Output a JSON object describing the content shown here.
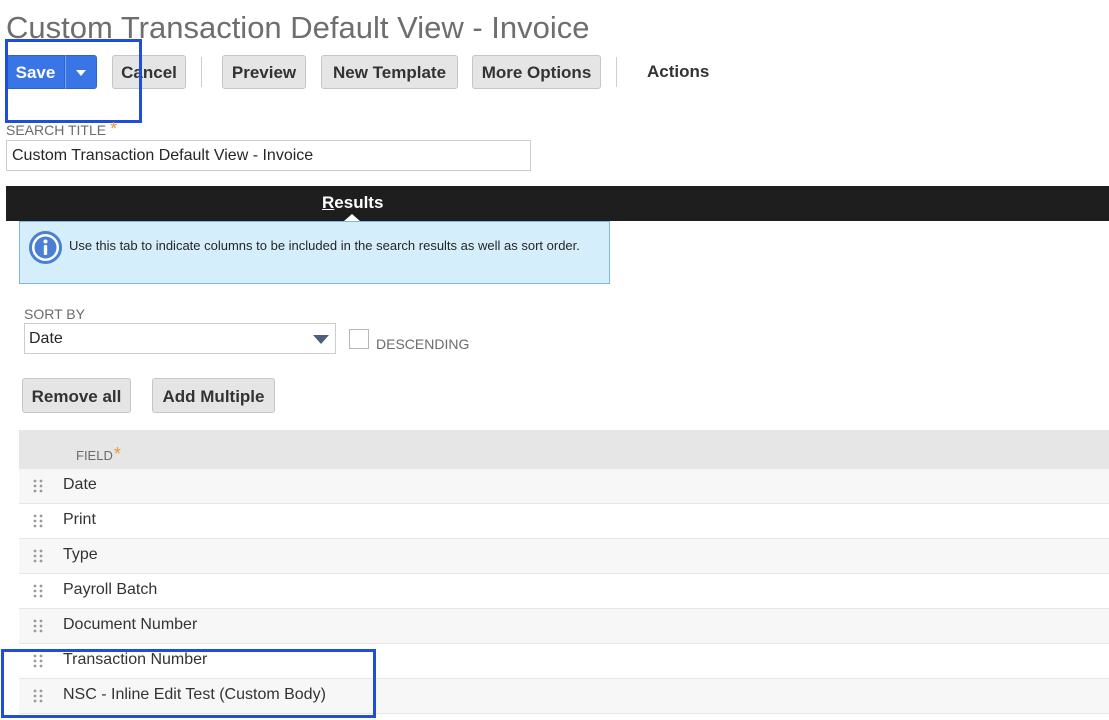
{
  "page": {
    "title": "Custom Transaction Default View - Invoice"
  },
  "toolbar": {
    "save_label": "Save",
    "cancel_label": "Cancel",
    "preview_label": "Preview",
    "new_template_label": "New Template",
    "more_options_label": "More Options",
    "actions_label": "Actions"
  },
  "search_title": {
    "label": "SEARCH TITLE",
    "required_mark": "*",
    "value": "Custom Transaction Default View - Invoice"
  },
  "tabs": {
    "results_first": "R",
    "results_rest": "esults"
  },
  "info": {
    "text": "Use this tab to indicate columns to be included in the search results as well as sort order."
  },
  "sort": {
    "label": "SORT BY",
    "value": "Date",
    "descending_label": "DESCENDING"
  },
  "buttons": {
    "remove_all": "Remove all",
    "add_multiple": "Add Multiple"
  },
  "table": {
    "field_header": "FIELD",
    "required_mark": "*",
    "rows": [
      "Date",
      "Print",
      "Type",
      "Payroll Batch",
      "Document Number",
      "Transaction Number",
      "NSC - Inline Edit Test (Custom Body)"
    ]
  },
  "colors": {
    "primary_button": "#3a75e6",
    "tab_bar": "#1e1e1e",
    "info_background": "#d5eefb",
    "highlight_box": "#1f4fd8",
    "required_asterisk": "#e39a3c"
  },
  "icons": {
    "info": "info-circle-icon",
    "save_menu": "caret-down-icon",
    "select": "caret-down-icon",
    "row_handle": "drag-handle-icon"
  }
}
